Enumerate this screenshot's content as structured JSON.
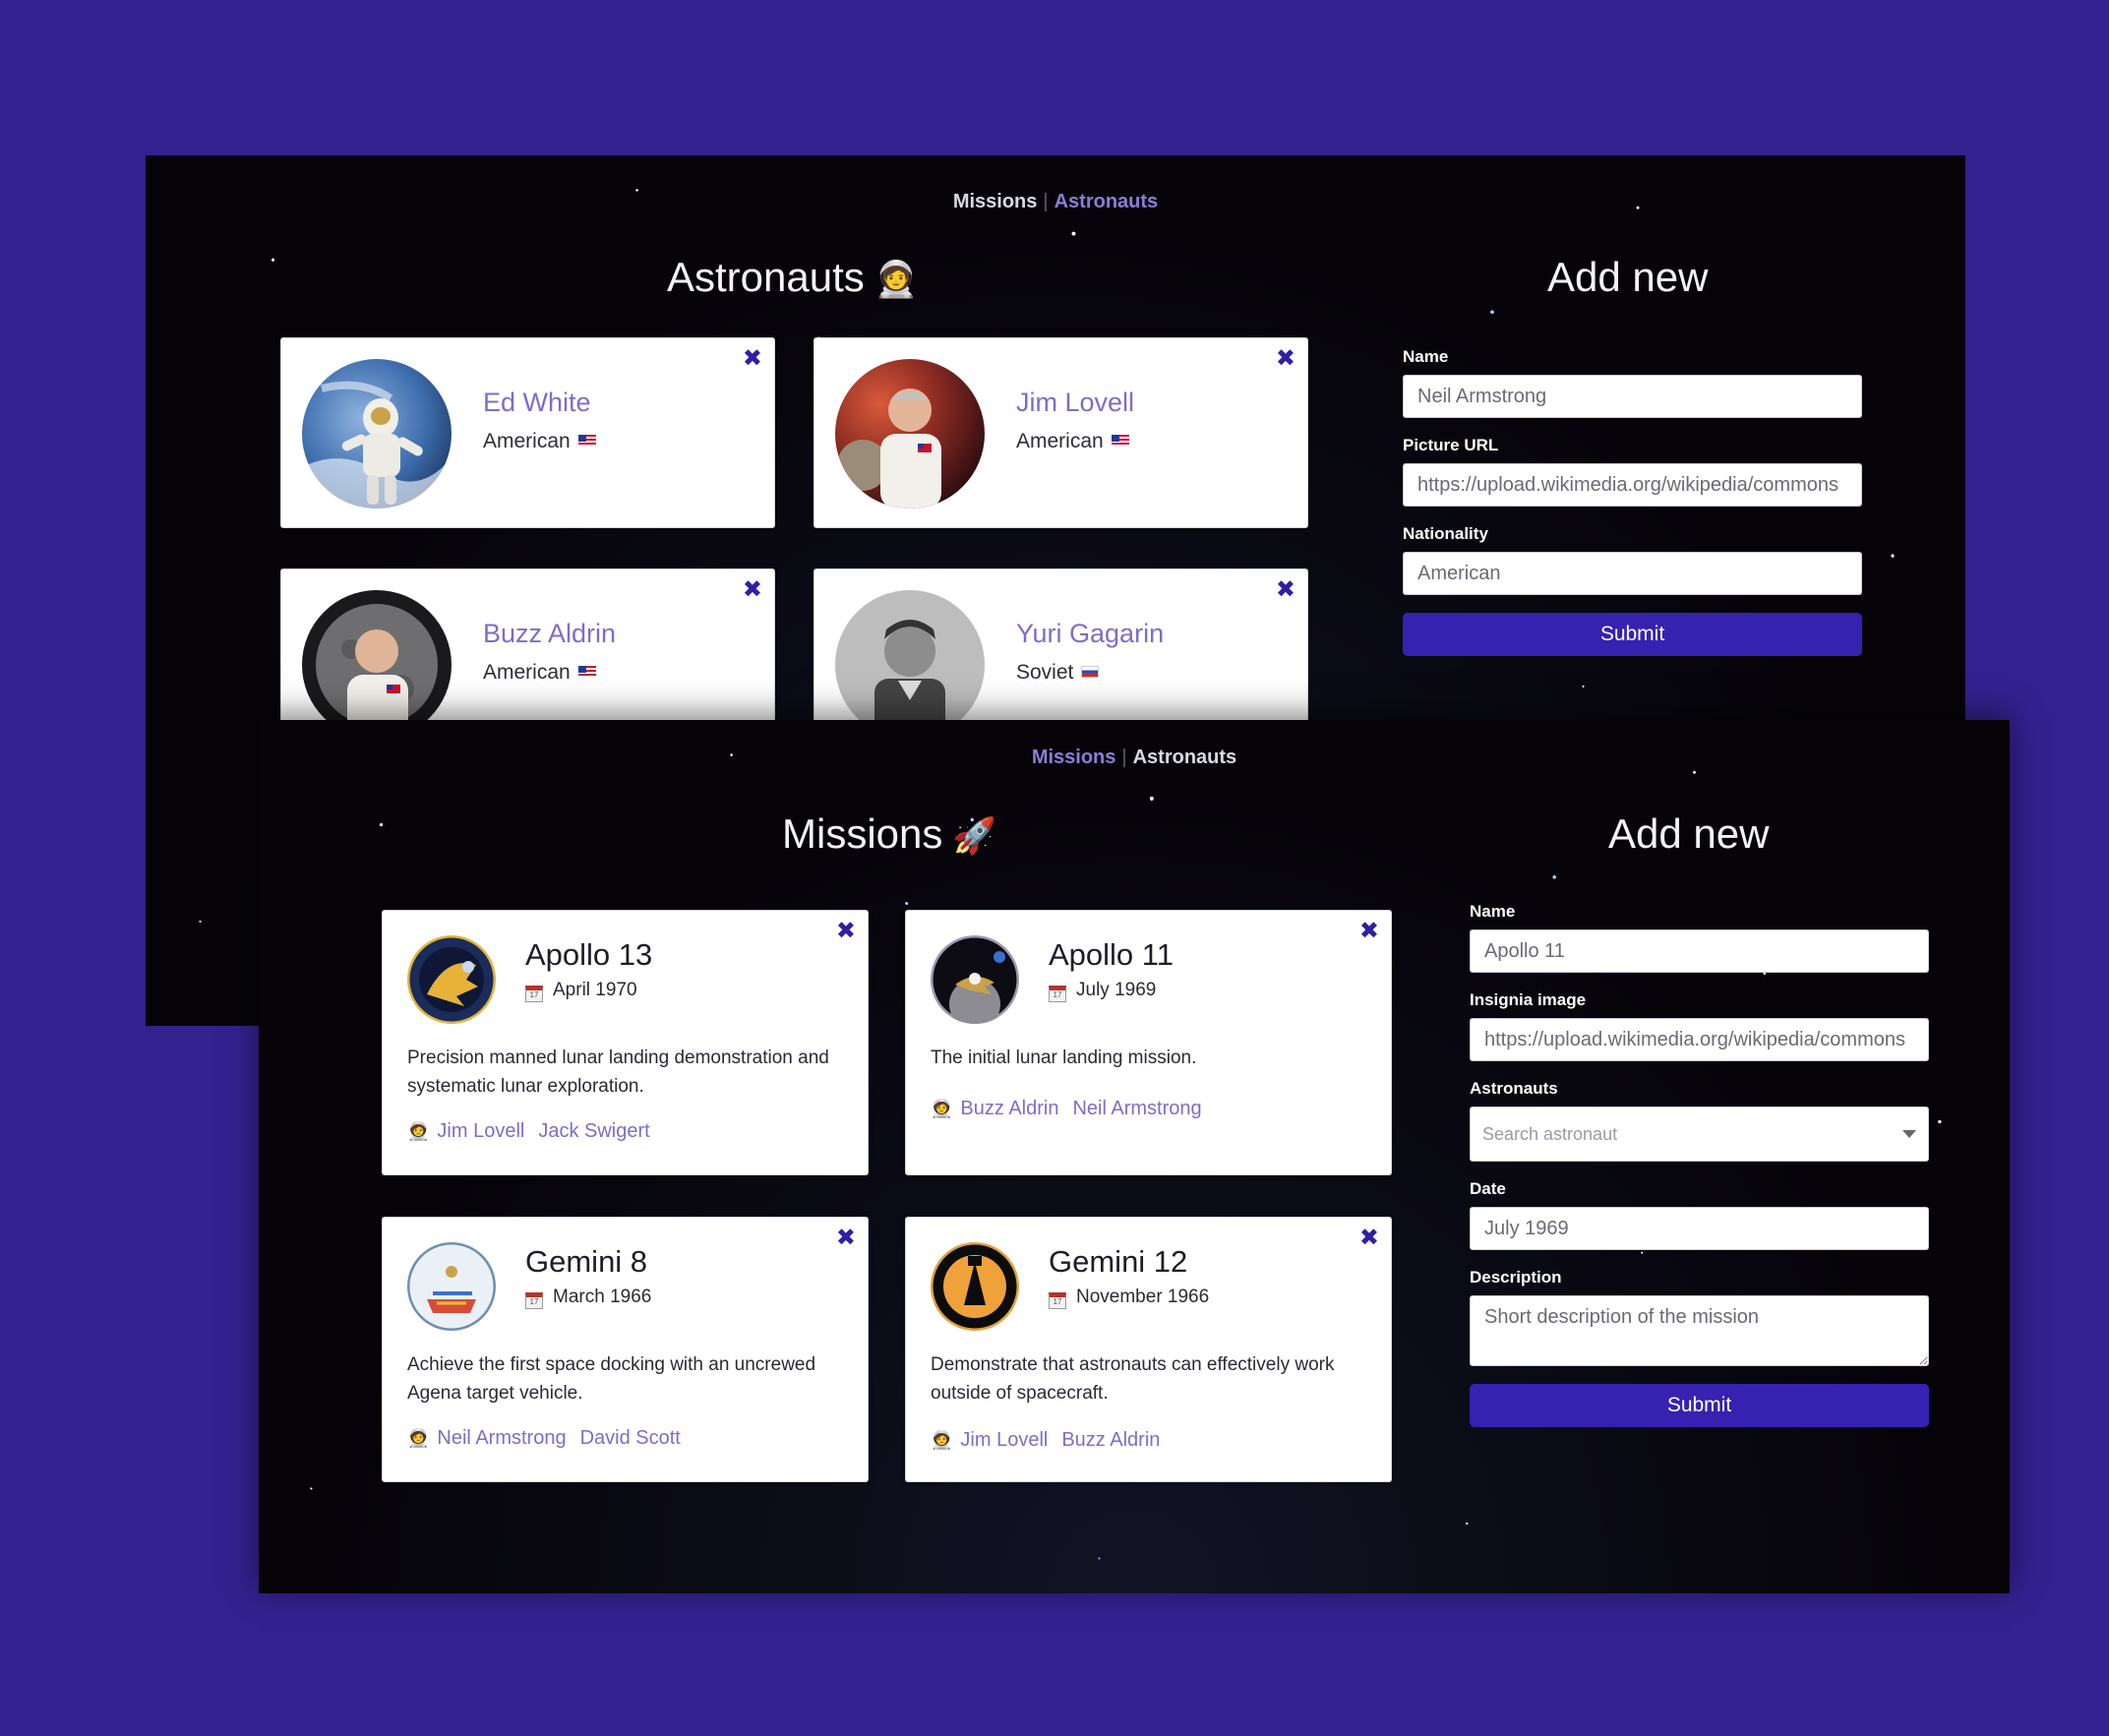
{
  "astronauts_screen": {
    "nav": {
      "missions": "Missions",
      "separator": "|",
      "astronauts": "Astronauts",
      "active": "astronauts"
    },
    "title": "Astronauts",
    "title_emoji": "🧑‍🚀",
    "close_symbol": "✖",
    "cards": [
      {
        "name": "Ed White",
        "nationality": "American",
        "flag": "flag-us-icon"
      },
      {
        "name": "Jim Lovell",
        "nationality": "American",
        "flag": "flag-us-icon"
      },
      {
        "name": "Buzz Aldrin",
        "nationality": "American",
        "flag": "flag-us-icon"
      },
      {
        "name": "Yuri Gagarin",
        "nationality": "Soviet",
        "flag": "flag-soviet-icon"
      }
    ],
    "form": {
      "title": "Add new",
      "name_label": "Name",
      "name_placeholder": "Neil Armstrong",
      "picture_label": "Picture URL",
      "picture_placeholder": "https://upload.wikimedia.org/wikipedia/commons",
      "nationality_label": "Nationality",
      "nationality_placeholder": "American",
      "submit": "Submit"
    }
  },
  "missions_screen": {
    "nav": {
      "missions": "Missions",
      "separator": "|",
      "astronauts": "Astronauts",
      "active": "missions"
    },
    "title": "Missions",
    "title_emoji": "🚀",
    "close_symbol": "✖",
    "cards": [
      {
        "name": "Apollo 13",
        "date": "April 1970",
        "description": "Precision manned lunar landing demonstration and systematic lunar exploration.",
        "crew": [
          "Jim Lovell",
          "Jack Swigert"
        ]
      },
      {
        "name": "Apollo 11",
        "date": "July 1969",
        "description": "The initial lunar landing mission.",
        "crew": [
          "Buzz Aldrin",
          "Neil Armstrong"
        ]
      },
      {
        "name": "Gemini 8",
        "date": "March 1966",
        "description": "Achieve the first space docking with an uncrewed Agena target vehicle.",
        "crew": [
          "Neil Armstrong",
          "David Scott"
        ]
      },
      {
        "name": "Gemini 12",
        "date": "November 1966",
        "description": "Demonstrate that astronauts can effectively work outside of spacecraft.",
        "crew": [
          "Jim Lovell",
          "Buzz Aldrin"
        ]
      }
    ],
    "crew_icon": "🧑‍🚀",
    "calendar_icon_text": "17",
    "form": {
      "title": "Add new",
      "name_label": "Name",
      "name_placeholder": "Apollo 11",
      "insignia_label": "Insignia image",
      "insignia_placeholder": "https://upload.wikimedia.org/wikipedia/commons",
      "astronauts_label": "Astronauts",
      "astronauts_placeholder": "Search astronaut",
      "date_label": "Date",
      "date_placeholder": "July 1969",
      "description_label": "Description",
      "description_placeholder": "Short description of the mission",
      "submit": "Submit"
    }
  },
  "colors": {
    "backdrop": "#33218f",
    "accent": "#3621b0",
    "link": "#7d6dc9",
    "close": "#2f1fa3"
  }
}
